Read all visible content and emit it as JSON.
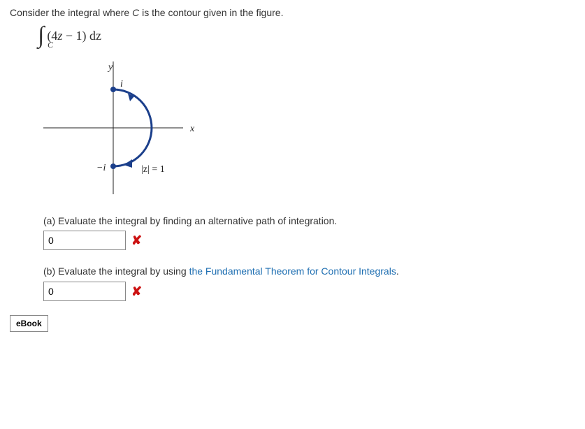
{
  "question": {
    "prompt_pre": "Consider the integral where ",
    "prompt_var": "C",
    "prompt_post": " is the contour given in the figure.",
    "integral": {
      "contour_sub": "C",
      "coef": "4",
      "var": "z",
      "minus_const": "1",
      "dvar": "dz"
    }
  },
  "figure": {
    "y_label": "y",
    "x_label": "x",
    "top_pt": "i",
    "bottom_pt": "−i",
    "mod_label": "|z| = 1"
  },
  "parts": {
    "a": {
      "label": "(a) Evaluate the integral by finding an alternative path of integration.",
      "answer_value": "0",
      "correct": false
    },
    "b": {
      "label_pre": "(b) Evaluate the integral by using ",
      "link_text": "the Fundamental Theorem for Contour Integrals",
      "label_post": ".",
      "answer_value": "0",
      "correct": false
    }
  },
  "ebook_label": "eBook",
  "chart_data": {
    "type": "diagram",
    "title": "Contour for integral of (4z − 1) around right half of |z|=1",
    "curve": "right half of the unit circle |z| = 1",
    "endpoints": [
      "i",
      "-i"
    ],
    "orientation": "from i clockwise (through +x axis) to -i",
    "axes": [
      "x",
      "y"
    ]
  }
}
